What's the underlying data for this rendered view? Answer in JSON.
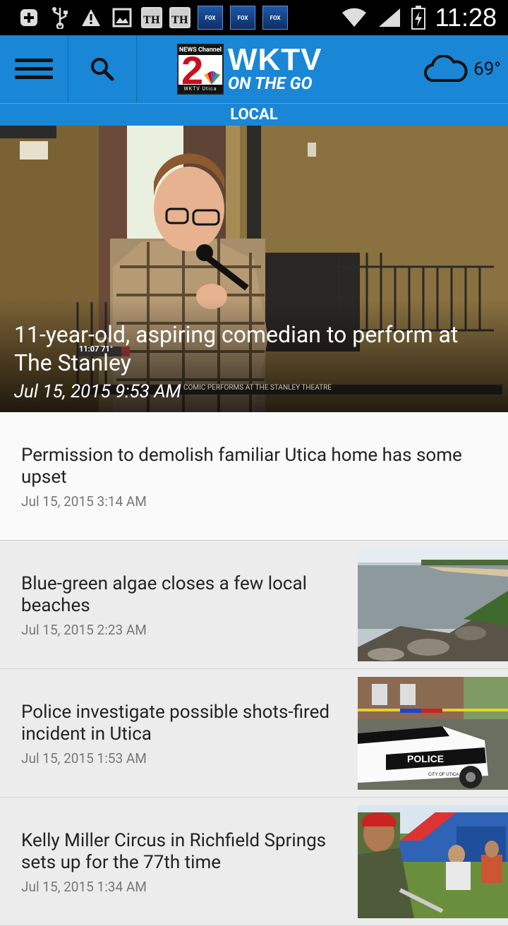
{
  "status_bar": {
    "time": "11:28",
    "box_label_1": "TH",
    "box_label_2": "TH",
    "fox_label": "FOX"
  },
  "header": {
    "logo_network": "NEWS Channel",
    "logo_number": "2",
    "logo_call_small": "WKTV Utica",
    "logo_title": "WKTV",
    "logo_subtitle": "ON THE GO",
    "temperature": "69°"
  },
  "section_title": "LOCAL",
  "hero": {
    "title": "11-year-old, aspiring comedian to perform at The Stanley",
    "date": "Jul 15, 2015 9:53 AM",
    "ticker_time": "11:07  71°",
    "ticker_text": "COMIC PERFORMS AT THE STANLEY THEATRE"
  },
  "articles": [
    {
      "title": "Permission to demolish familiar Utica home has some upset",
      "date": "Jul 15, 2015 3:14 AM"
    },
    {
      "title": "Blue-green algae closes a few local beaches",
      "date": "Jul 15, 2015 2:23 AM"
    },
    {
      "title": "Police investigate possible shots-fired incident in Utica",
      "date": "Jul 15, 2015 1:53 AM"
    },
    {
      "title": "Kelly Miller Circus in Richfield Springs sets up for the 77th time",
      "date": "Jul 15, 2015 1:34 AM"
    }
  ],
  "thumbs": {
    "police_text": "POLICE",
    "police_sub": "CITY OF UTICA"
  },
  "colors": {
    "header_blue": "#1a86d6",
    "statusbar": "#000000"
  }
}
